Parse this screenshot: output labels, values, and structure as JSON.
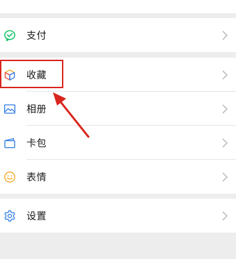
{
  "groups": {
    "pay": {
      "items": [
        {
          "label": "支付",
          "icon": "wechat-pay-icon",
          "icon_color": "#07c160"
        }
      ]
    },
    "main": {
      "items": [
        {
          "label": "收藏",
          "icon": "favorites-cube-icon",
          "icon_color": "#f5a623"
        },
        {
          "label": "相册",
          "icon": "album-icon",
          "icon_color": "#2c7be5"
        },
        {
          "label": "卡包",
          "icon": "card-wallet-icon",
          "icon_color": "#2c7be5"
        },
        {
          "label": "表情",
          "icon": "sticker-smiley-icon",
          "icon_color": "#f5a623"
        }
      ]
    },
    "settings": {
      "items": [
        {
          "label": "设置",
          "icon": "settings-gear-icon",
          "icon_color": "#2c7be5"
        }
      ]
    }
  },
  "annotation": {
    "highlight_target": "收藏",
    "color": "#d9251d"
  }
}
